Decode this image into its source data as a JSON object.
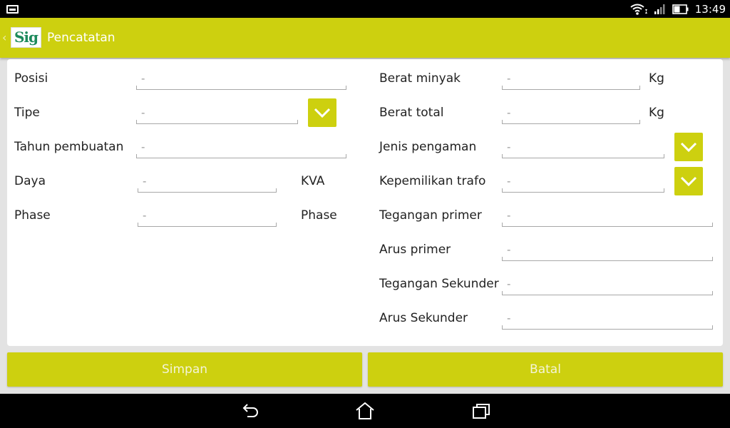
{
  "status": {
    "time": "13:49"
  },
  "appbar": {
    "back": "‹",
    "logo": "Sig",
    "title": "Pencatatan"
  },
  "left": [
    {
      "label": "Posisi",
      "value": "-",
      "unit": ""
    },
    {
      "label": "Tipe",
      "value": "-",
      "unit": ""
    },
    {
      "label": "Tahun pembuatan",
      "value": "-",
      "unit": ""
    },
    {
      "label": "Daya",
      "value": "-",
      "unit": "KVA"
    },
    {
      "label": "Phase",
      "value": "-",
      "unit": "Phase"
    }
  ],
  "right": [
    {
      "label": "Berat minyak",
      "value": "-",
      "unit": "Kg"
    },
    {
      "label": "Berat total",
      "value": "-",
      "unit": "Kg"
    },
    {
      "label": "Jenis pengaman",
      "value": "-"
    },
    {
      "label": "Kepemilikan trafo",
      "value": "-"
    },
    {
      "label": "Tegangan primer",
      "value": "-"
    },
    {
      "label": "Arus primer",
      "value": "-"
    },
    {
      "label": "Tegangan Sekunder",
      "value": "-"
    },
    {
      "label": "Arus Sekunder",
      "value": "-"
    }
  ],
  "buttons": {
    "save": "Simpan",
    "cancel": "Batal"
  },
  "colors": {
    "accent": "#cdd00f",
    "statusbar": "#000000"
  }
}
